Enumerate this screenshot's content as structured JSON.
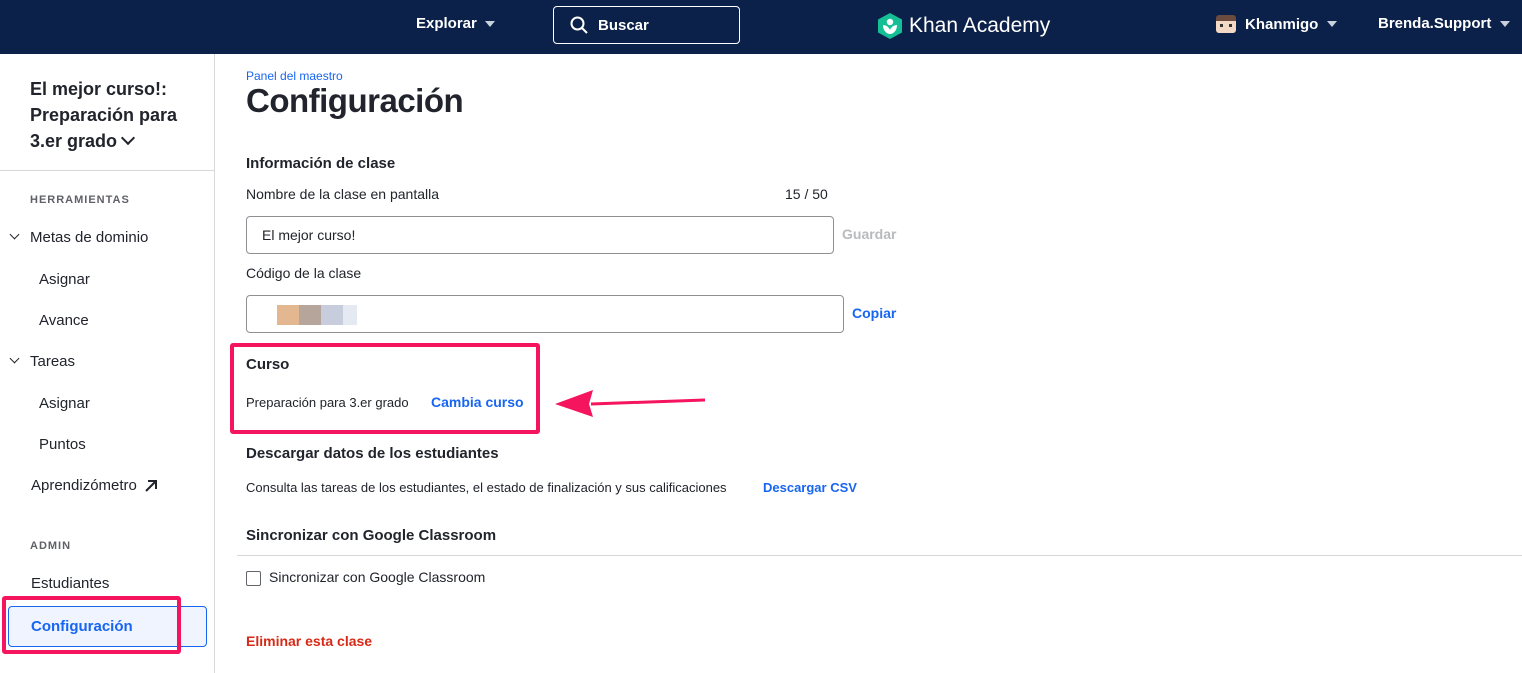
{
  "topbar": {
    "explore_label": "Explorar",
    "search_label": "Buscar",
    "logo_text": "Khan Academy",
    "khanmigo_label": "Khanmigo",
    "user_label": "Brenda.Support",
    "bg_color": "#0b2149"
  },
  "sidebar": {
    "course_title": "El mejor curso!: Preparación para 3.er grado",
    "tools_label": "HERRAMIENTAS",
    "items": [
      {
        "label": "Metas de dominio",
        "icon": "chevron-down-icon"
      },
      {
        "label": "Asignar"
      },
      {
        "label": "Avance"
      },
      {
        "label": "Tareas",
        "icon": "chevron-down-icon"
      },
      {
        "label": "Asignar"
      },
      {
        "label": "Puntos"
      },
      {
        "label": "Aprendizómetro",
        "icon": "external-arrow-icon"
      }
    ],
    "admin_label": "ADMIN",
    "admin_items": [
      {
        "label": "Estudiantes"
      },
      {
        "label": "Configuración",
        "active": true
      }
    ]
  },
  "main": {
    "breadcrumb": "Panel del maestro",
    "title": "Configuración",
    "class_info_heading": "Información de clase",
    "display_name_label": "Nombre de la clase en pantalla",
    "display_name_counter": "15 / 50",
    "display_name_value": "El mejor curso!",
    "save_label": "Guardar",
    "class_code_label": "Código de la clase",
    "copy_label": "Copiar",
    "course_heading": "Curso",
    "course_value": "Preparación para 3.er grado",
    "change_course_label": "Cambia curso",
    "download_heading": "Descargar datos de los estudiantes",
    "download_desc": "Consulta las tareas de los estudiantes, el estado de finalización y sus calificaciones",
    "download_csv_label": "Descargar CSV",
    "sync_heading": "Sincronizar con Google Classroom",
    "sync_checkbox_label": "Sincronizar con Google Classroom",
    "sync_checked": false,
    "delete_label": "Eliminar esta clase"
  },
  "colors": {
    "accent": "#1865f2",
    "highlight": "#f5155f",
    "danger": "#d92916"
  }
}
